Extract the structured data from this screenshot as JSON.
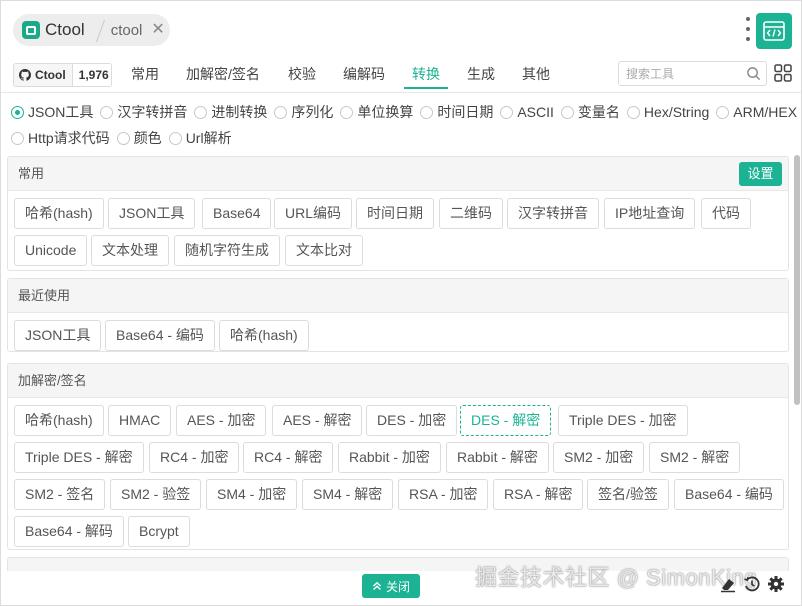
{
  "header": {
    "tabs": [
      {
        "label": "Ctool",
        "active": true
      },
      {
        "label": "ctool",
        "active": false
      }
    ],
    "close_glyph": "✕"
  },
  "github": {
    "label": "Ctool",
    "stars": "1,976"
  },
  "categories": [
    "常用",
    "加解密/签名",
    "校验",
    "编解码",
    "转换",
    "生成",
    "其他"
  ],
  "active_category": "转换",
  "search": {
    "placeholder": "搜索工具",
    "value": ""
  },
  "features": {
    "row1": [
      "JSON工具",
      "汉字转拼音",
      "进制转换",
      "序列化",
      "单位换算",
      "时间日期",
      "ASCII",
      "变量名",
      "Hex/String",
      "ARM/HEX"
    ],
    "row2": [
      "Http请求代码",
      "颜色",
      "Url解析"
    ],
    "selected": "JSON工具"
  },
  "panels": {
    "common": {
      "title": "常用",
      "settings_label": "设置",
      "tools": [
        "哈希(hash)",
        "JSON工具",
        "Base64",
        "URL编码",
        "时间日期",
        "二维码",
        "汉字转拼音",
        "IP地址查询",
        "代码",
        "Unicode",
        "文本处理",
        "随机字符生成",
        "文本比对"
      ]
    },
    "recent": {
      "title": "最近使用",
      "tools": [
        "JSON工具",
        "Base64 - 编码",
        "哈希(hash)"
      ]
    },
    "crypto": {
      "title": "加解密/签名",
      "tools": [
        "哈希(hash)",
        "HMAC",
        "AES - 加密",
        "AES - 解密",
        "DES - 加密",
        "DES - 解密",
        "Triple DES - 加密",
        "Triple DES - 解密",
        "RC4 - 加密",
        "RC4 - 解密",
        "Rabbit - 加密",
        "Rabbit - 解密",
        "SM2 - 加密",
        "SM2 - 解密",
        "SM2 - 签名",
        "SM2 - 验签",
        "SM4 - 加密",
        "SM4 - 解密",
        "RSA - 加密",
        "RSA - 解密",
        "签名/验签",
        "Base64 - 编码",
        "Base64 - 解码",
        "Bcrypt"
      ],
      "highlighted": "DES - 解密"
    }
  },
  "bottom": {
    "close_label": "关闭",
    "watermark": "掘金技术社区 @ SimonKing"
  },
  "colors": {
    "accent": "#1cb394",
    "border": "#dcdcdc",
    "panel_head": "#f5f5f5"
  },
  "icons": [
    "app-logo-icon",
    "close-icon",
    "kebab-menu-icon",
    "code-icon",
    "github-icon",
    "search-icon",
    "grid-icon",
    "chevron-up-icon",
    "eraser-icon",
    "history-icon",
    "settings-icon"
  ]
}
